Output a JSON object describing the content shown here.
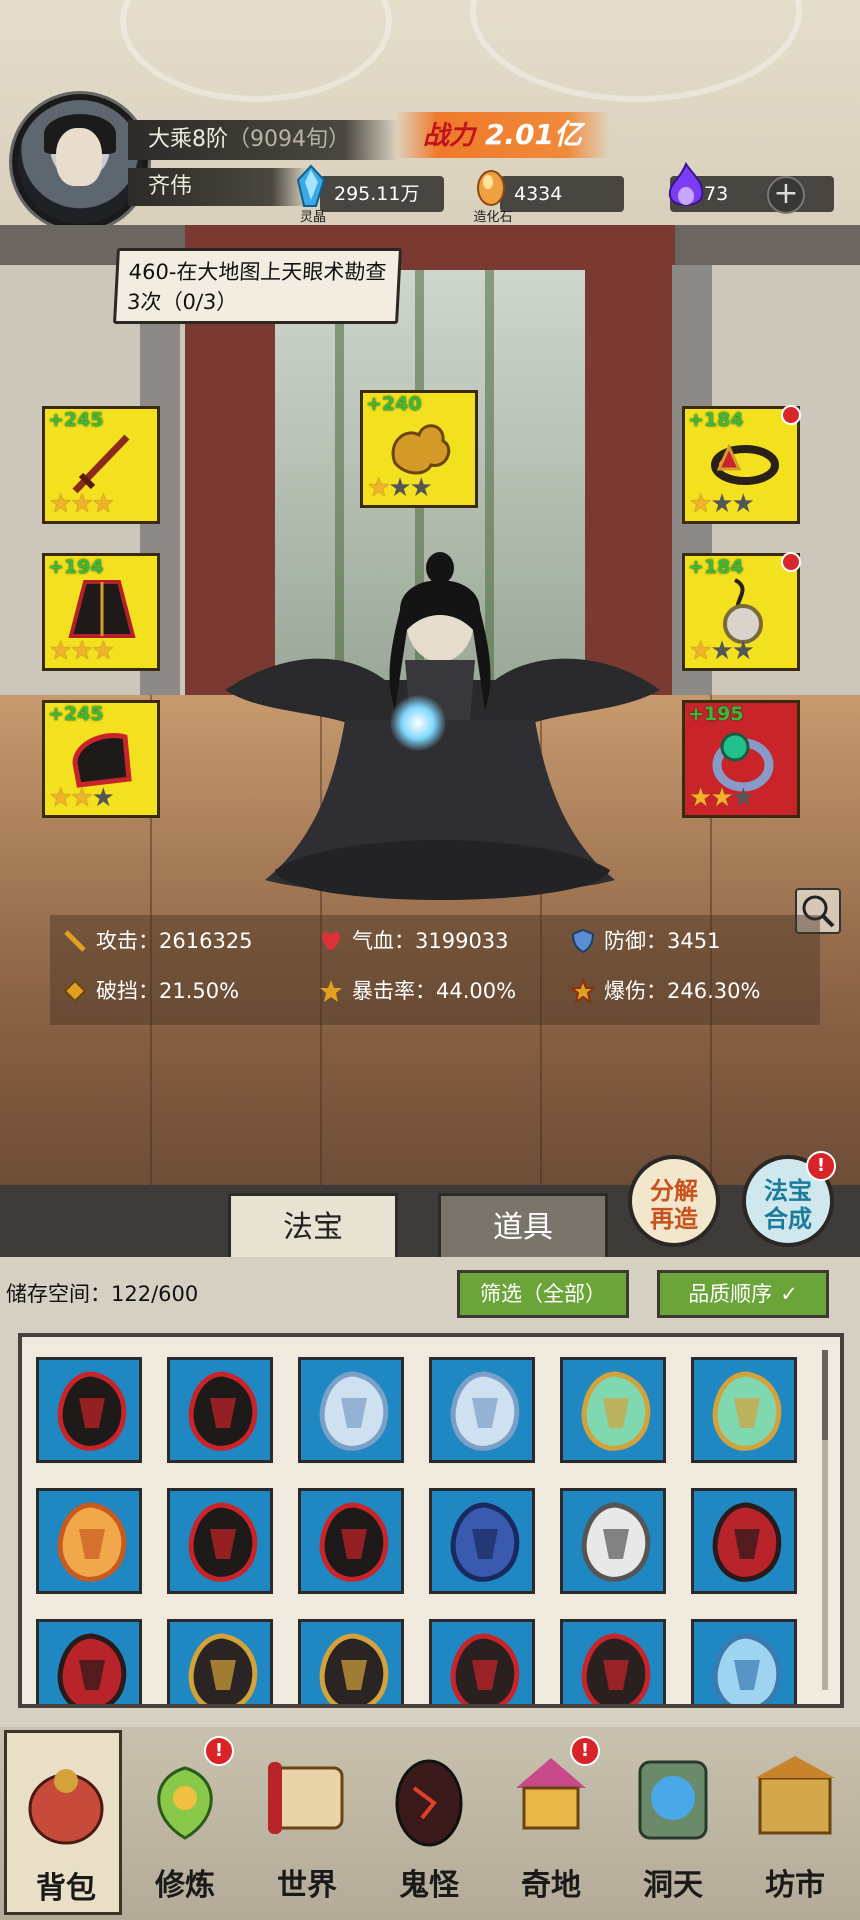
{
  "player": {
    "realm": "大乘8阶",
    "realm_sub": "（9094旬）",
    "name": "齐伟",
    "power_label": "战力",
    "power_value": "2.01亿"
  },
  "resources": [
    {
      "caption": "灵晶",
      "value": "295.11万",
      "icon": "blue-crystal-icon",
      "color": "#3aa9e8"
    },
    {
      "caption": "造化石",
      "value": "4334",
      "icon": "orange-stone-icon",
      "color": "#f0a040"
    },
    {
      "caption": "",
      "value": "73",
      "icon": "purple-flame-icon",
      "color": "#7b3df2"
    }
  ],
  "plus_label": "+",
  "quest": {
    "text": "460-在大地图上天眼术勘查3次（0/3）"
  },
  "equipment": [
    {
      "bonus": "+245",
      "stars": 3,
      "max": 3,
      "icon": "sword-icon",
      "bg": "#f3e120",
      "dot": false
    },
    {
      "bonus": "+240",
      "stars": 1,
      "max": 3,
      "icon": "cloud-ornament-icon",
      "bg": "#f3e120",
      "dot": false
    },
    {
      "bonus": "+184",
      "stars": 1,
      "max": 3,
      "icon": "headband-icon",
      "bg": "#f3e120",
      "dot": true
    },
    {
      "bonus": "+194",
      "stars": 3,
      "max": 3,
      "icon": "robe-icon",
      "bg": "#f3e120",
      "dot": false
    },
    {
      "bonus": "+184",
      "stars": 1,
      "max": 3,
      "icon": "pendant-icon",
      "bg": "#f3e120",
      "dot": true
    },
    {
      "bonus": "+245",
      "stars": 2,
      "max": 3,
      "icon": "boots-icon",
      "bg": "#f3e120",
      "dot": false
    },
    {
      "bonus": "+195",
      "stars": 2,
      "max": 3,
      "icon": "ring-icon",
      "bg": "#c8242a",
      "dot": false
    }
  ],
  "stats": [
    {
      "label": "攻击：",
      "value": "2616325",
      "icon": "attack-icon",
      "color": "#e0a020"
    },
    {
      "label": "气血：",
      "value": "3199033",
      "icon": "heart-icon",
      "color": "#e0303a"
    },
    {
      "label": "防御：",
      "value": "3451",
      "icon": "shield-icon",
      "color": "#5a8ed0"
    },
    {
      "label": "破挡：",
      "value": "21.50%",
      "icon": "break-icon",
      "color": "#e0a020"
    },
    {
      "label": "暴击率：",
      "value": "44.00%",
      "icon": "crit-icon",
      "color": "#e0a020"
    },
    {
      "label": "爆伤：",
      "value": "246.30%",
      "icon": "crit-damage-icon",
      "color": "#e0a020"
    }
  ],
  "tabs": {
    "fabao": "法宝",
    "daoju": "道具"
  },
  "actions": {
    "decompose": "分解再造",
    "synthesize": "法宝合成",
    "badge": "!"
  },
  "storage": {
    "label": "储存空间：",
    "value": "122/600"
  },
  "filter_label": "筛选（全部）",
  "sort_label": "品质顺序",
  "sort_chevron": "✓",
  "inventory_items": [
    "dark-gauntlet-icon",
    "dark-gauntlet-icon",
    "ice-sword-icon",
    "ice-sword-icon",
    "jade-fan-icon",
    "jade-fan-icon",
    "golden-armor-icon",
    "red-robe-icon",
    "red-robe-icon",
    "blue-robe-icon",
    "white-robe-icon",
    "red-armor-icon",
    "red-helm-icon",
    "bracer-icon",
    "bracer-icon",
    "dark-boots-icon",
    "dark-boots-icon",
    "crystal-boots-icon"
  ],
  "nav": [
    {
      "label": "背包",
      "icon": "bag-icon",
      "active": true,
      "badge": false
    },
    {
      "label": "修炼",
      "icon": "lotus-icon",
      "active": false,
      "badge": true
    },
    {
      "label": "世界",
      "icon": "scroll-map-icon",
      "active": false,
      "badge": false
    },
    {
      "label": "鬼怪",
      "icon": "demon-egg-icon",
      "active": false,
      "badge": false
    },
    {
      "label": "奇地",
      "icon": "pagoda-icon",
      "active": false,
      "badge": true
    },
    {
      "label": "洞天",
      "icon": "portal-icon",
      "active": false,
      "badge": false
    },
    {
      "label": "坊市",
      "icon": "market-icon",
      "active": false,
      "badge": false
    }
  ]
}
